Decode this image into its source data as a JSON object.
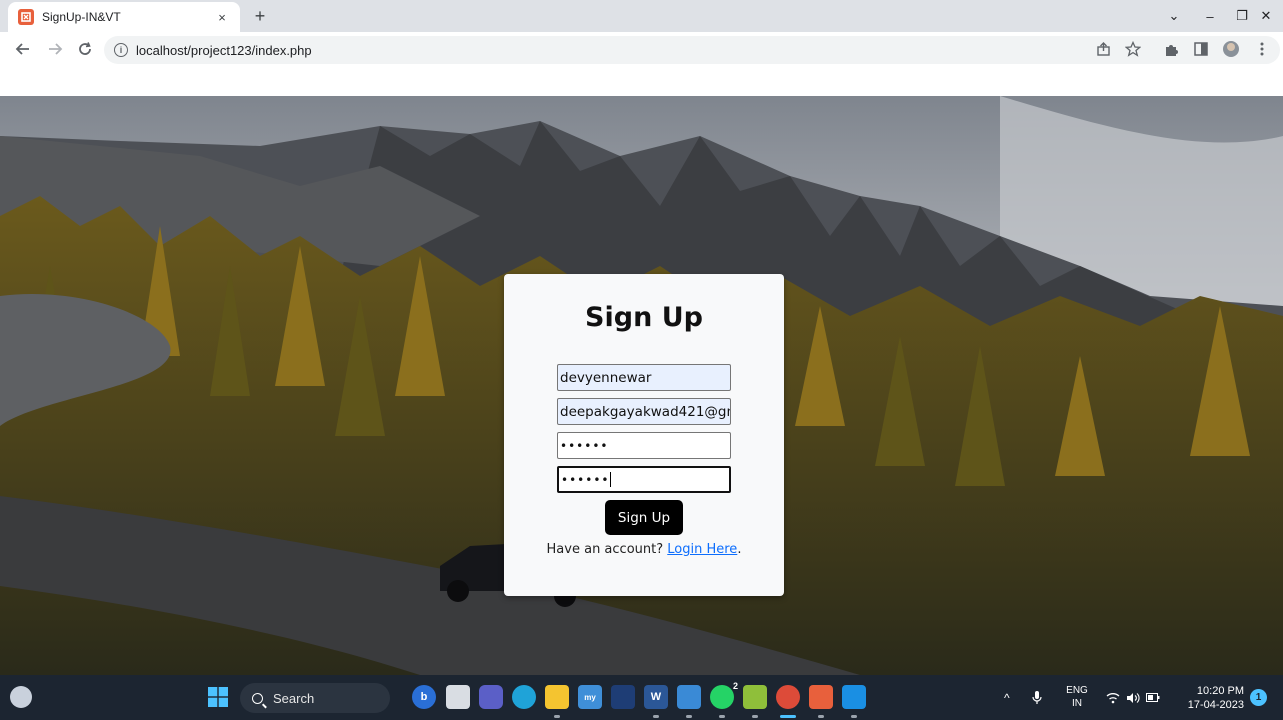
{
  "browser": {
    "tab_title": "SignUp-IN&VT",
    "tab_close_glyph": "×",
    "new_tab_glyph": "+",
    "url": "localhost/project123/index.php",
    "window_controls": [
      "⌄",
      "–",
      "❐",
      "✕"
    ]
  },
  "form": {
    "title": "Sign Up",
    "username_value": "devyennewar",
    "email_value": "deepakgayakwad421@gm",
    "password_value": "••••••",
    "confirm_password_value": "••••••",
    "submit_label": "Sign Up",
    "account_prompt": "Have an account?",
    "login_link_label": "Login Here",
    "trailing_period": "."
  },
  "taskbar": {
    "search_placeholder": "Search",
    "language_line1": "ENG",
    "language_line2": "IN",
    "time": "10:20 PM",
    "date": "17-04-2023",
    "notification_count": "1",
    "whatsapp_badge": "2"
  },
  "colors": {
    "accent_link": "#0d6efd",
    "button_bg": "#000000",
    "taskbar_bg": "#1c2531"
  }
}
